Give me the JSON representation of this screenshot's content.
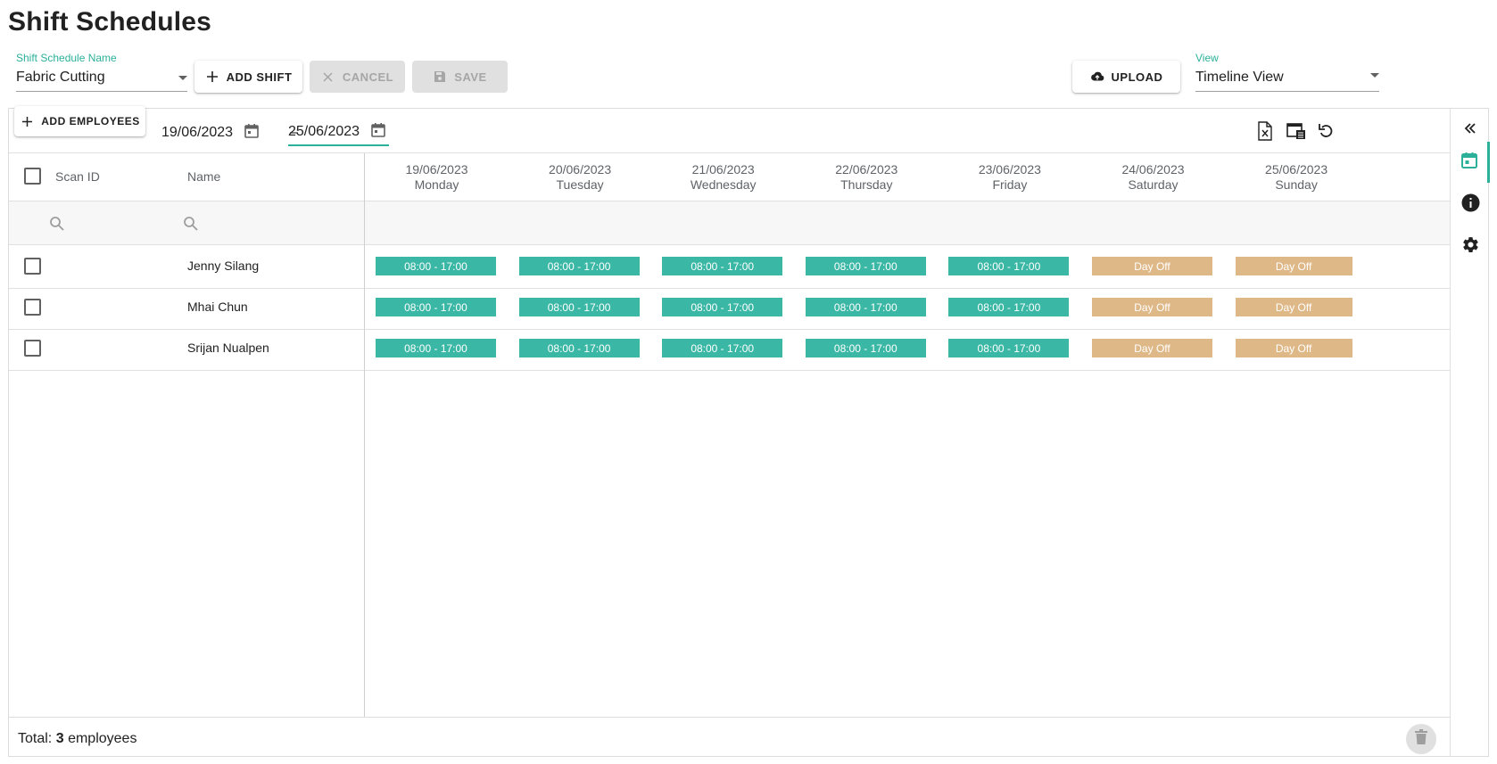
{
  "page": {
    "title": "Shift Schedules"
  },
  "schedule_field": {
    "label": "Shift Schedule Name",
    "value": "Fabric Cutting"
  },
  "actions": {
    "add_shift": "ADD SHIFT",
    "cancel": "CANCEL",
    "save": "SAVE",
    "upload": "UPLOAD"
  },
  "view_field": {
    "label": "View",
    "value": "Timeline View"
  },
  "toolbar": {
    "add_employees": "ADD EMPLOYEES",
    "date_from": "19/06/2023",
    "date_separator": "–",
    "date_to": "25/06/2023"
  },
  "table": {
    "columns": {
      "scan_id": "Scan ID",
      "name": "Name"
    },
    "days": [
      {
        "date": "19/06/2023",
        "weekday": "Monday"
      },
      {
        "date": "20/06/2023",
        "weekday": "Tuesday"
      },
      {
        "date": "21/06/2023",
        "weekday": "Wednesday"
      },
      {
        "date": "22/06/2023",
        "weekday": "Thursday"
      },
      {
        "date": "23/06/2023",
        "weekday": "Friday"
      },
      {
        "date": "24/06/2023",
        "weekday": "Saturday"
      },
      {
        "date": "25/06/2023",
        "weekday": "Sunday"
      }
    ],
    "rows": [
      {
        "scan_id": "",
        "name": "Jenny Silang",
        "shifts": [
          "08:00 - 17:00",
          "08:00 - 17:00",
          "08:00 - 17:00",
          "08:00 - 17:00",
          "08:00 - 17:00",
          "Day Off",
          "Day Off"
        ]
      },
      {
        "scan_id": "",
        "name": "Mhai Chun",
        "shifts": [
          "08:00 - 17:00",
          "08:00 - 17:00",
          "08:00 - 17:00",
          "08:00 - 17:00",
          "08:00 - 17:00",
          "Day Off",
          "Day Off"
        ]
      },
      {
        "scan_id": "",
        "name": "Srijan Nualpen",
        "shifts": [
          "08:00 - 17:00",
          "08:00 - 17:00",
          "08:00 - 17:00",
          "08:00 - 17:00",
          "08:00 - 17:00",
          "Day Off",
          "Day Off"
        ]
      }
    ]
  },
  "footer": {
    "total_label": "Total:",
    "total_count": "3",
    "total_suffix": "employees"
  },
  "colors": {
    "accent": "#2bb09a",
    "work_shift": "#3bb7a5",
    "day_off": "#dfb887"
  },
  "icons": {
    "toolbar": [
      "excel-export-icon",
      "column-settings-icon",
      "refresh-icon"
    ],
    "side_rail": [
      "collapse-left-icon",
      "calendar-icon",
      "info-icon",
      "settings-gear-icon"
    ],
    "footer": [
      "delete-trash-icon"
    ]
  }
}
